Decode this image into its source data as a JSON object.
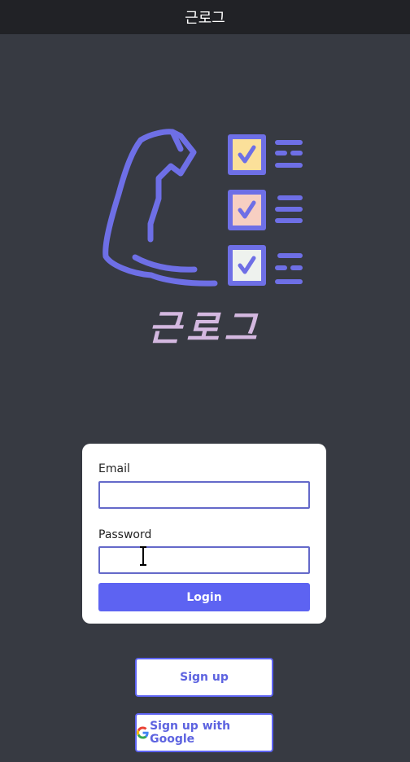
{
  "header": {
    "title": "근로그"
  },
  "logo": {
    "text": "근로그",
    "colors": {
      "primary": "#6e6fe6",
      "box_1_fill": "#fbe09a",
      "box_2_fill": "#f7cfc2",
      "box_3_fill": "#eef2ee",
      "logo_text": "#d4b8e0"
    }
  },
  "login_form": {
    "email_label": "Email",
    "email_value": "",
    "password_label": "Password",
    "password_value": "",
    "login_label": "Login"
  },
  "signup": {
    "label": "Sign up"
  },
  "google_signup": {
    "label": "Sign up with Google"
  },
  "colors": {
    "background": "#373a42",
    "header_bg": "#212226",
    "accent": "#5d63f2"
  }
}
